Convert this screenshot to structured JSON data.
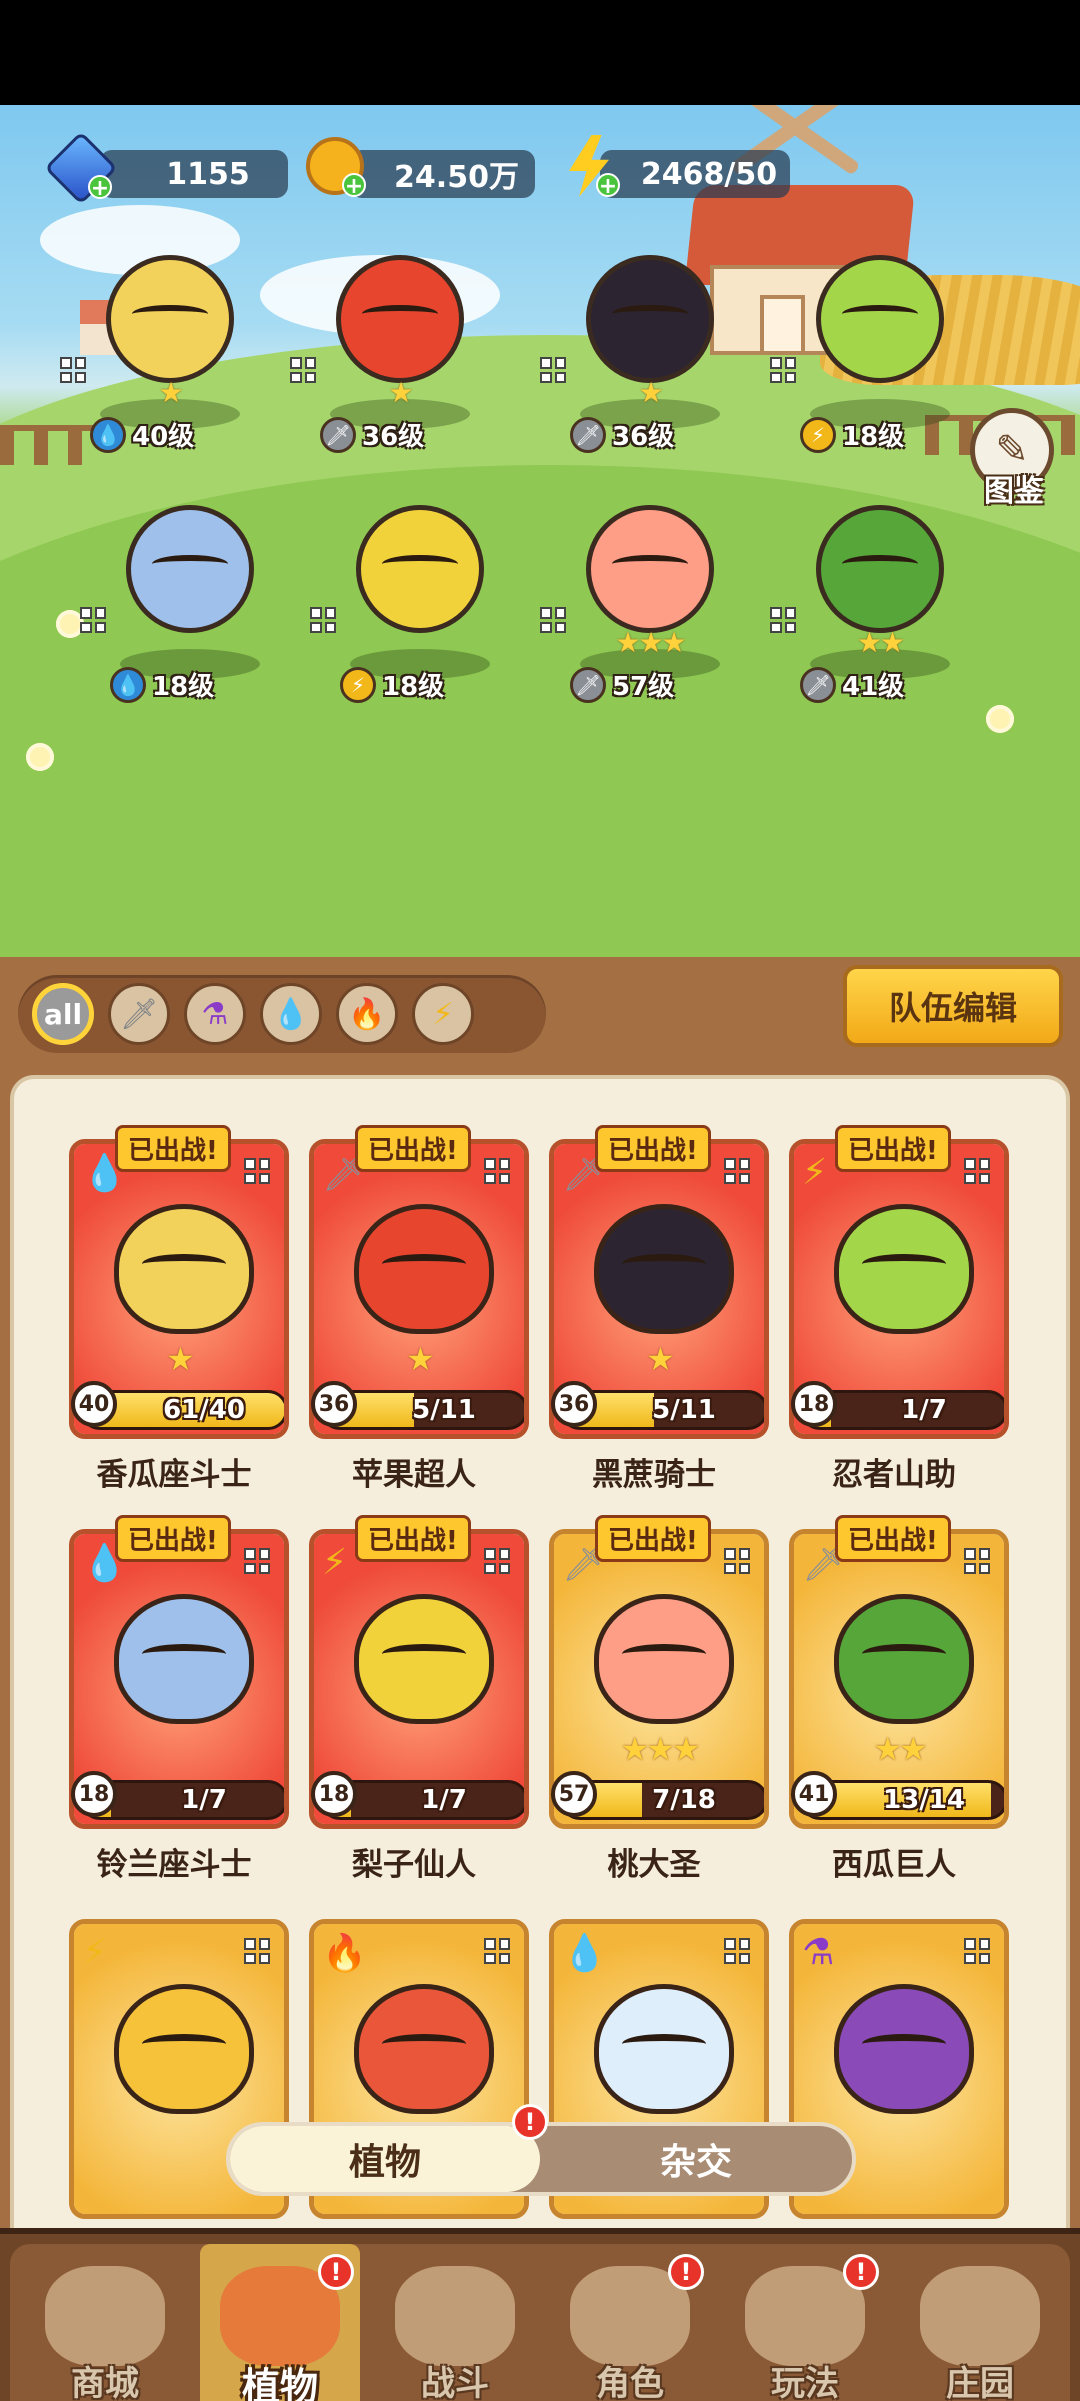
{
  "resources": {
    "gems": "1155",
    "coins": "24.50万",
    "energy": "2468/50"
  },
  "codex_label": "图鉴",
  "lineup": [
    {
      "level": "40级",
      "element": "water",
      "stars": "★",
      "color": "#f2d25a"
    },
    {
      "level": "36级",
      "element": "sword",
      "stars": "★",
      "color": "#e8452e"
    },
    {
      "level": "36级",
      "element": "sword",
      "stars": "★",
      "color": "#2c2430"
    },
    {
      "level": "18级",
      "element": "lightning",
      "stars": "",
      "color": "#a4d64a"
    },
    {
      "level": "18级",
      "element": "water",
      "stars": "",
      "color": "#9fc0ea"
    },
    {
      "level": "18级",
      "element": "lightning",
      "stars": "",
      "color": "#f2d23a"
    },
    {
      "level": "57级",
      "element": "sword",
      "stars": "★★★",
      "color": "#ff9e86"
    },
    {
      "level": "41级",
      "element": "sword",
      "stars": "★★",
      "color": "#56a63a"
    }
  ],
  "filters": [
    "all",
    "sword",
    "potion",
    "water",
    "fire",
    "lightning"
  ],
  "filter_all_label": "all",
  "team_edit_label": "队伍编辑",
  "deployed_label": "已出战!",
  "cards": [
    {
      "name": "香瓜座斗士",
      "level": "40",
      "exp": "61/40",
      "exp_fill": 1.0,
      "stars": "★",
      "rarity": "red",
      "element": "water",
      "deployed": true,
      "color": "#f2d25a"
    },
    {
      "name": "苹果超人",
      "level": "36",
      "exp": "5/11",
      "exp_fill": 0.45,
      "stars": "★",
      "rarity": "red",
      "element": "sword",
      "deployed": true,
      "color": "#e8452e"
    },
    {
      "name": "黑蔗骑士",
      "level": "36",
      "exp": "5/11",
      "exp_fill": 0.45,
      "stars": "★",
      "rarity": "red",
      "element": "sword",
      "deployed": true,
      "color": "#2c2430"
    },
    {
      "name": "忍者山助",
      "level": "18",
      "exp": "1/7",
      "exp_fill": 0.14,
      "stars": "",
      "rarity": "red",
      "element": "lightning",
      "deployed": true,
      "color": "#a4d64a"
    },
    {
      "name": "铃兰座斗士",
      "level": "18",
      "exp": "1/7",
      "exp_fill": 0.14,
      "stars": "",
      "rarity": "red",
      "element": "water",
      "deployed": true,
      "color": "#9fc0ea"
    },
    {
      "name": "梨子仙人",
      "level": "18",
      "exp": "1/7",
      "exp_fill": 0.14,
      "stars": "",
      "rarity": "red",
      "element": "lightning",
      "deployed": true,
      "color": "#f2d23a"
    },
    {
      "name": "桃大圣",
      "level": "57",
      "exp": "7/18",
      "exp_fill": 0.39,
      "stars": "★★★",
      "rarity": "gold",
      "element": "sword",
      "deployed": true,
      "color": "#ff9e86"
    },
    {
      "name": "西瓜巨人",
      "level": "41",
      "exp": "13/14",
      "exp_fill": 0.93,
      "stars": "★★",
      "rarity": "gold",
      "element": "sword",
      "deployed": true,
      "color": "#56a63a"
    },
    {
      "name": "",
      "level": "",
      "exp": "",
      "exp_fill": 0,
      "stars": "",
      "rarity": "gold",
      "element": "lightning",
      "deployed": false,
      "color": "#f5c23a"
    },
    {
      "name": "",
      "level": "",
      "exp": "",
      "exp_fill": 0,
      "stars": "",
      "rarity": "gold",
      "element": "fire",
      "deployed": false,
      "color": "#e9563a"
    },
    {
      "name": "",
      "level": "",
      "exp": "",
      "exp_fill": 0,
      "stars": "",
      "rarity": "gold",
      "element": "water",
      "deployed": false,
      "color": "#dfeefb"
    },
    {
      "name": "",
      "level": "",
      "exp": "",
      "exp_fill": 0,
      "stars": "",
      "rarity": "gold",
      "element": "potion",
      "deployed": false,
      "color": "#8a4ab8"
    }
  ],
  "toggle": {
    "plants": "植物",
    "hybrid": "杂交",
    "alert": "!"
  },
  "nav": [
    {
      "label": "商城",
      "active": false,
      "alert": false
    },
    {
      "label": "植物",
      "active": true,
      "alert": true
    },
    {
      "label": "战斗",
      "active": false,
      "alert": false
    },
    {
      "label": "角色",
      "active": false,
      "alert": true
    },
    {
      "label": "玩法",
      "active": false,
      "alert": true
    },
    {
      "label": "庄园",
      "active": false,
      "alert": false
    }
  ]
}
